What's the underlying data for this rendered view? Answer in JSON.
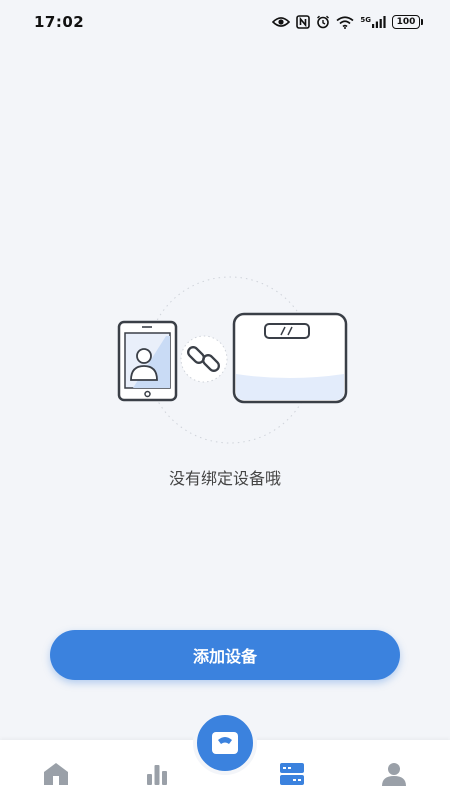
{
  "status_bar": {
    "time": "17:02",
    "network": "5G",
    "battery": "100",
    "icons": [
      "eye-icon",
      "nfc-icon",
      "alarm-icon",
      "wifi-icon",
      "signal-icon",
      "battery-icon"
    ]
  },
  "empty_state": {
    "message": "没有绑定设备哦",
    "illustration": [
      "phone-icon",
      "link-icon",
      "scale-icon"
    ]
  },
  "actions": {
    "add_device_label": "添加设备"
  },
  "bottom_nav": {
    "items": [
      {
        "icon": "home-icon"
      },
      {
        "icon": "chart-icon"
      },
      {
        "icon": "scale-icon"
      },
      {
        "icon": "device-list-icon"
      },
      {
        "icon": "profile-icon"
      }
    ]
  },
  "colors": {
    "accent": "#3b82de",
    "background": "#f3f5f9",
    "nav_inactive": "#9aa0a8"
  }
}
